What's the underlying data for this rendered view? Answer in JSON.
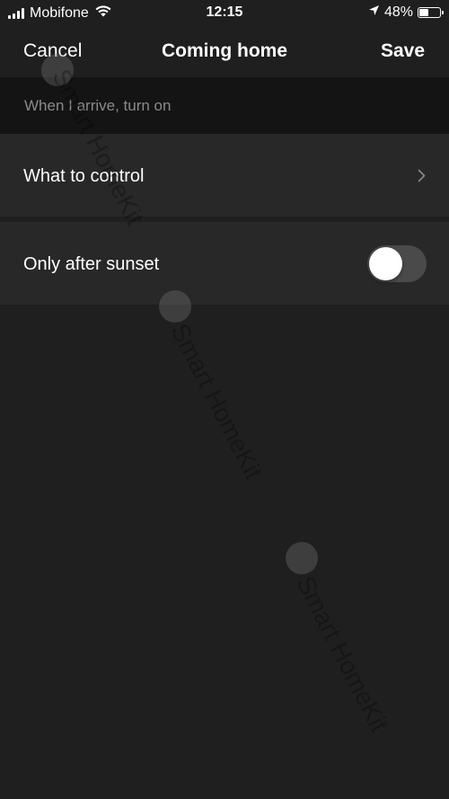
{
  "status_bar": {
    "carrier": "Mobifone",
    "time": "12:15",
    "battery_percent": "48%",
    "battery_level": 0.48,
    "icons": [
      "signal-icon",
      "wifi-icon",
      "location-arrow-icon",
      "battery-icon"
    ]
  },
  "nav": {
    "cancel_label": "Cancel",
    "title": "Coming home",
    "save_label": "Save"
  },
  "section": {
    "header": "When I arrive, turn on"
  },
  "rows": [
    {
      "label": "What to control",
      "accessory": "chevron-right-icon"
    },
    {
      "label": "Only after sunset",
      "accessory": "toggle",
      "toggle_on": false
    }
  ],
  "watermark": {
    "text": "Smart HomeKit"
  },
  "colors": {
    "background": "#1f1f1f",
    "row_background": "#282828",
    "header_background": "#141414",
    "header_text": "#8a8a8a",
    "toggle_off": "#4a4a4a"
  }
}
